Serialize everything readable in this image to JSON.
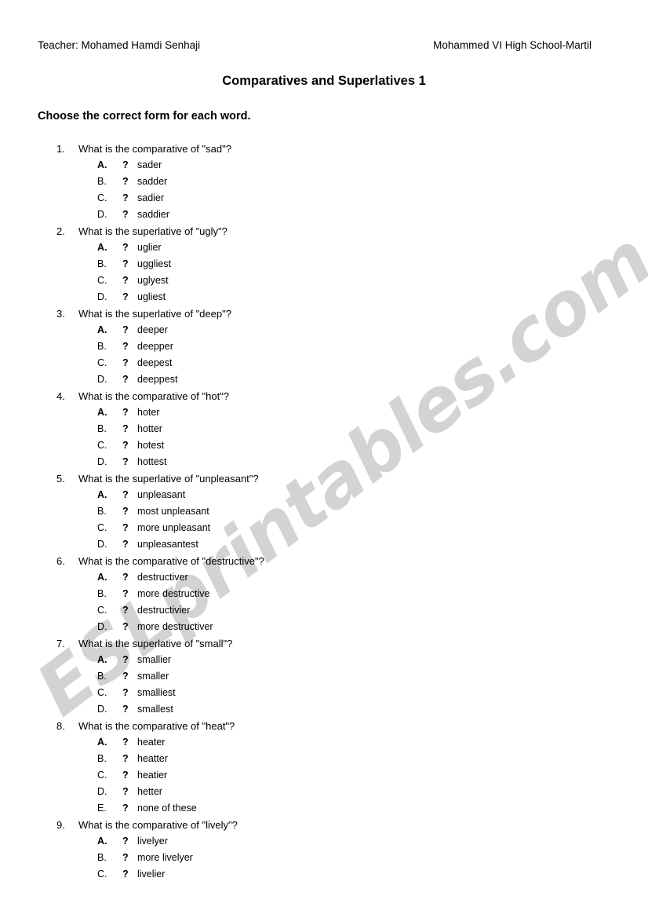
{
  "header": {
    "left": "Teacher: Mohamed Hamdi Senhaji",
    "right": "Mohammed VI High School-Martil"
  },
  "title": "Comparatives and Superlatives 1",
  "instruction": "Choose the correct form for each word.",
  "watermark": {
    "text": "ESLprintables.com",
    "color": "#d3d3d3"
  },
  "option_mark": "?",
  "questions": [
    {
      "number": "1.",
      "text": "What is the comparative of \"sad\"?",
      "options": [
        {
          "letter": "A.",
          "mark": "?",
          "text": "sader"
        },
        {
          "letter": "B.",
          "mark": "?",
          "text": "sadder"
        },
        {
          "letter": "C.",
          "mark": "?",
          "text": "sadier"
        },
        {
          "letter": "D.",
          "mark": "?",
          "text": "saddier"
        }
      ]
    },
    {
      "number": "2.",
      "text": "What is the superlative of \"ugly\"?",
      "options": [
        {
          "letter": "A.",
          "mark": "?",
          "text": "uglier"
        },
        {
          "letter": "B.",
          "mark": "?",
          "text": "uggliest"
        },
        {
          "letter": "C.",
          "mark": "?",
          "text": "uglyest"
        },
        {
          "letter": "D.",
          "mark": "?",
          "text": "ugliest"
        }
      ]
    },
    {
      "number": "3.",
      "text": "What is the superlative of \"deep\"?",
      "options": [
        {
          "letter": "A.",
          "mark": "?",
          "text": "deeper"
        },
        {
          "letter": "B.",
          "mark": "?",
          "text": "deepper"
        },
        {
          "letter": "C.",
          "mark": "?",
          "text": "deepest"
        },
        {
          "letter": "D.",
          "mark": "?",
          "text": "deeppest"
        }
      ]
    },
    {
      "number": "4.",
      "text": "What is the comparative of \"hot\"?",
      "options": [
        {
          "letter": "A.",
          "mark": "?",
          "text": "hoter"
        },
        {
          "letter": "B.",
          "mark": "?",
          "text": "hotter"
        },
        {
          "letter": "C.",
          "mark": "?",
          "text": "hotest"
        },
        {
          "letter": "D.",
          "mark": "?",
          "text": "hottest"
        }
      ]
    },
    {
      "number": "5.",
      "text": "What is the superlative of \"unpleasant\"?",
      "options": [
        {
          "letter": "A.",
          "mark": "?",
          "text": "unpleasant"
        },
        {
          "letter": "B.",
          "mark": "?",
          "text": "most unpleasant"
        },
        {
          "letter": "C.",
          "mark": "?",
          "text": "more unpleasant"
        },
        {
          "letter": "D.",
          "mark": "?",
          "text": "unpleasantest"
        }
      ]
    },
    {
      "number": "6.",
      "text": "What is the comparative of \"destructive\"?",
      "options": [
        {
          "letter": "A.",
          "mark": "?",
          "text": "destructiver"
        },
        {
          "letter": "B.",
          "mark": "?",
          "text": "more destructive"
        },
        {
          "letter": "C.",
          "mark": "?",
          "text": "destructivier"
        },
        {
          "letter": "D.",
          "mark": "?",
          "text": "more destructiver"
        }
      ]
    },
    {
      "number": "7.",
      "text": "What is the superlative of \"small\"?",
      "options": [
        {
          "letter": "A.",
          "mark": "?",
          "text": "smallier"
        },
        {
          "letter": "B.",
          "mark": "?",
          "text": "smaller"
        },
        {
          "letter": "C.",
          "mark": "?",
          "text": "smalliest"
        },
        {
          "letter": "D.",
          "mark": "?",
          "text": "smallest"
        }
      ]
    },
    {
      "number": "8.",
      "text": "What is the comparative of \"heat\"?",
      "options": [
        {
          "letter": "A.",
          "mark": "?",
          "text": "heater"
        },
        {
          "letter": "B.",
          "mark": "?",
          "text": "heatter"
        },
        {
          "letter": "C.",
          "mark": "?",
          "text": "heatier"
        },
        {
          "letter": "D.",
          "mark": "?",
          "text": "hetter"
        },
        {
          "letter": "E.",
          "mark": "?",
          "text": "none of these"
        }
      ]
    },
    {
      "number": "9.",
      "text": "What is the comparative of \"lively\"?",
      "options": [
        {
          "letter": "A.",
          "mark": "?",
          "text": "livelyer"
        },
        {
          "letter": "B.",
          "mark": "?",
          "text": "more livelyer"
        },
        {
          "letter": "C.",
          "mark": "?",
          "text": "livelier"
        }
      ]
    }
  ]
}
